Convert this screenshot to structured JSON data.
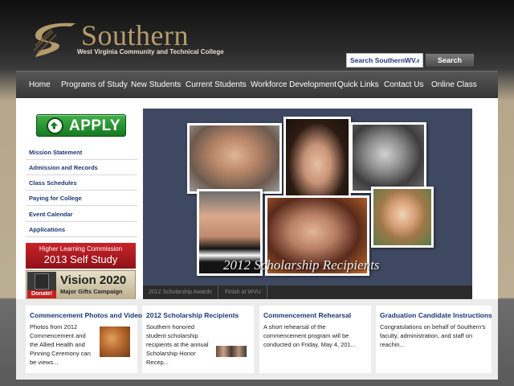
{
  "colors": {
    "brand_gold": "#b69b6b",
    "nav_bg": "#3f3f3f",
    "link_blue": "#1a3873",
    "apply_green": "#2b9535",
    "hlc_red": "#b31c22"
  },
  "header": {
    "logo_icon": "swoosh-s-logo-icon",
    "logo_name": "Southern",
    "logo_subtitle": "West Virginia Community and Technical College",
    "search_value": "Search SouthernWV.edu",
    "search_button": "Search"
  },
  "nav": {
    "items": [
      {
        "label": "Home"
      },
      {
        "label": "Programs of Study"
      },
      {
        "label": "New Students"
      },
      {
        "label": "Current Students"
      },
      {
        "label": "Workforce Development"
      },
      {
        "label": "Quick Links"
      },
      {
        "label": "Contact Us"
      },
      {
        "label": "Online Class"
      }
    ]
  },
  "sidebar": {
    "apply_label": "APPLY",
    "apply_icon": "up-arrow-circle-icon",
    "links": [
      {
        "label": "Mission Statement"
      },
      {
        "label": "Admission and Records"
      },
      {
        "label": "Class Schedules"
      },
      {
        "label": "Paying for College"
      },
      {
        "label": "Event Calendar"
      },
      {
        "label": "Applications"
      }
    ],
    "hlc_small": "Higher Learning Commission",
    "hlc_big": "2013 Self Study",
    "vision_title": "Vision 2020",
    "vision_sub": "Major Gifts Campaign",
    "vision_donate": "Donate!",
    "vision_icon": "gift-box-icon"
  },
  "slideshow": {
    "caption": "2012 Scholarship Recipients",
    "tabs": [
      {
        "label": "2012 Scholarship Awards"
      },
      {
        "label": "Finish at WVU"
      }
    ]
  },
  "cards": [
    {
      "title": "Commencement Photos and Video",
      "body": "Photos from 2012 Commencement and the Allied Health and Pinning Ceremony can be views..."
    },
    {
      "title": "2012 Scholarship Recipients",
      "body": "Southern honored student scholarship recipients at the annual Scholarship Honor Recep..."
    },
    {
      "title": "Commencement Rehearsal",
      "body": "A short rehearsal of the commencement program will be conducted on Friday, May 4, 201..."
    },
    {
      "title": "Graduation Candidate Instructions",
      "body": "Congratulations on behalf of Southern's faculty, administration, and staff on reachin..."
    }
  ]
}
